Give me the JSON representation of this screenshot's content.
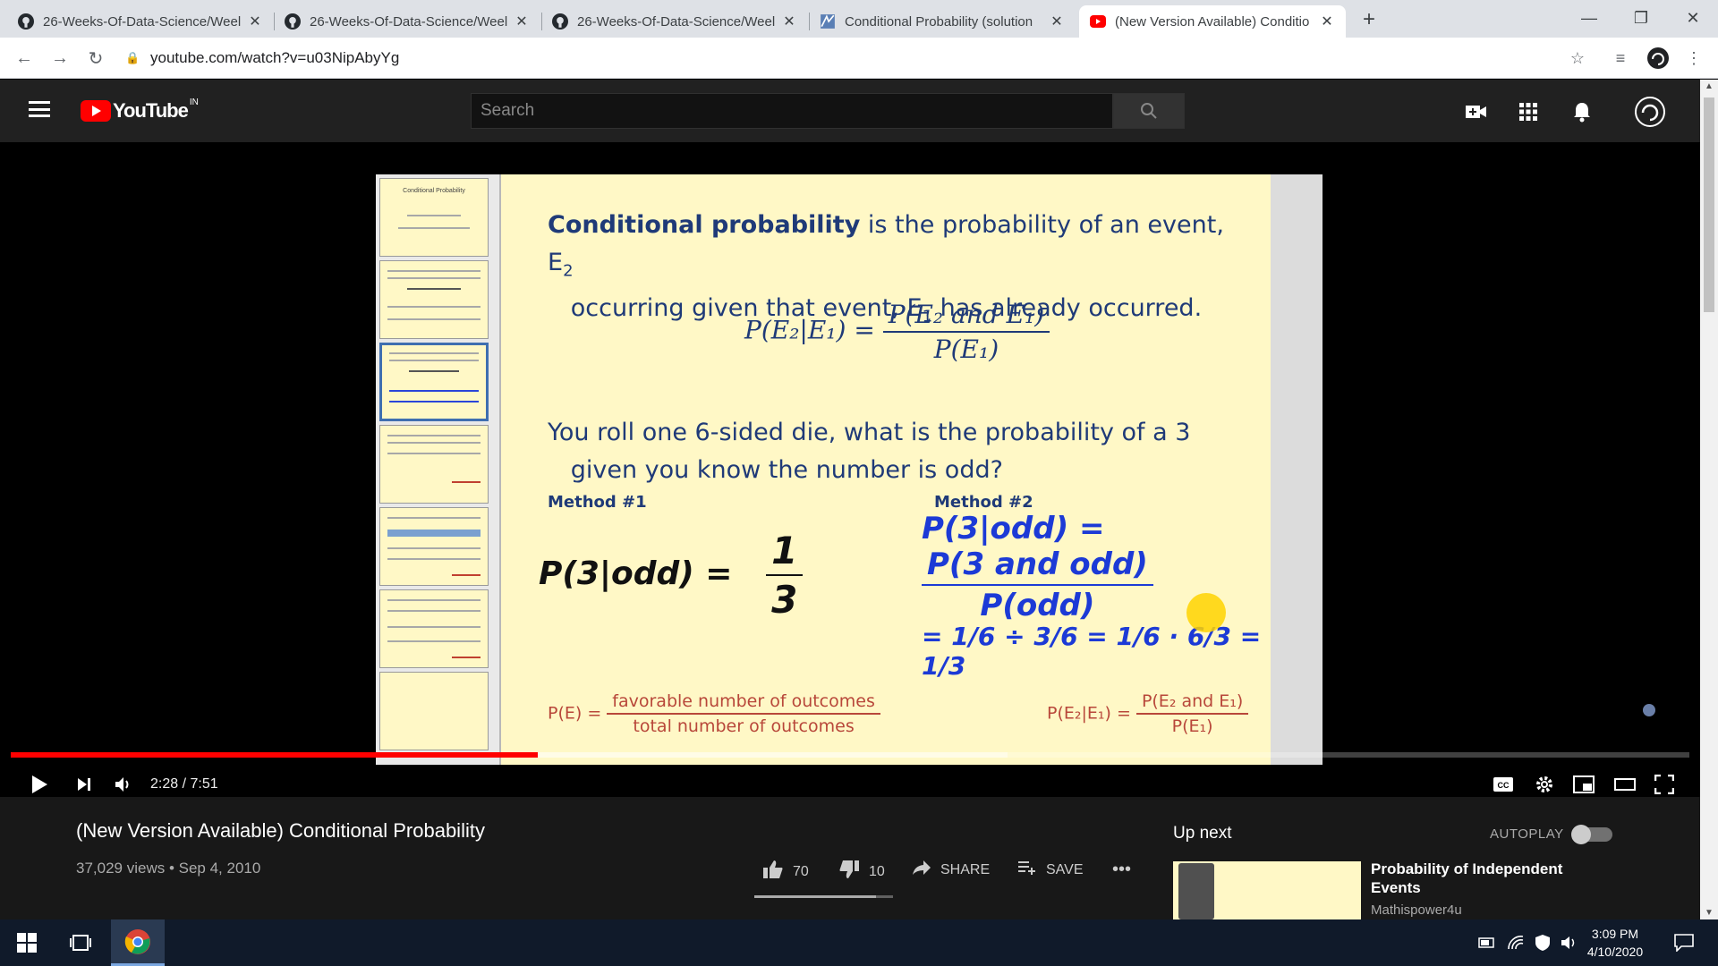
{
  "browser": {
    "tabs": [
      {
        "title": "26-Weeks-Of-Data-Science/Weel",
        "icon": "github-icon"
      },
      {
        "title": "26-Weeks-Of-Data-Science/Weel",
        "icon": "github-icon"
      },
      {
        "title": "26-Weeks-Of-Data-Science/Weel",
        "icon": "github-icon"
      },
      {
        "title": "Conditional Probability (solution",
        "icon": "site-icon"
      },
      {
        "title": "(New Version Available) Conditio",
        "icon": "youtube-icon"
      }
    ],
    "url": "youtube.com/watch?v=u03NipAbyYg"
  },
  "youtube": {
    "logo_text": "YouTube",
    "region": "IN",
    "search_placeholder": "Search"
  },
  "slide": {
    "definition_lead": "Conditional probability",
    "definition_rest": " is the probability of an event, E",
    "definition_sub2": "2",
    "definition_line2a": "occurring given that event, E",
    "definition_sub1": "1",
    "definition_line2b": " has already occurred.",
    "formula_lhs": "P(E₂|E₁) =",
    "formula_num": "P(E₂ and E₁)",
    "formula_den": "P(E₁)",
    "question_line1": "You roll one 6-sided die, what is the probability of a 3",
    "question_line2": "given you know the number is odd?",
    "method1": "Method #1",
    "method2": "Method #2",
    "hand1_lhs": "P(3|odd) =",
    "hand1_num": "1",
    "hand1_den": "3",
    "hand2_lhs": "P(3|odd) =",
    "hand2_num": "P(3 and odd)",
    "hand2_den": "P(odd)",
    "hand2_line2": "= 1/6 ÷ 3/6 = 1/6 · 6/3 = 1/3",
    "red1_lhs": "P(E) =",
    "red1_num": "favorable number of outcomes",
    "red1_den": "total number of outcomes",
    "red2_lhs": "P(E₂|E₁) =",
    "red2_num": "P(E₂ and E₁)",
    "red2_den": "P(E₁)",
    "thumb_title": "Conditional Probability"
  },
  "player": {
    "time": "2:28 / 7:51",
    "played_fraction": 0.314,
    "loaded_fraction": 0.28
  },
  "video": {
    "title": "(New Version Available) Conditional Probability",
    "meta": "37,029 views • Sep 4, 2010",
    "likes": "70",
    "dislikes": "10",
    "share": "SHARE",
    "save": "SAVE",
    "like_ratio": 0.875
  },
  "upnext": {
    "label": "Up next",
    "autoplay": "AUTOPLAY",
    "title": "Probability of Independent Events",
    "channel": "Mathispower4u"
  },
  "taskbar": {
    "time": "3:09 PM",
    "date": "4/10/2020"
  },
  "colors": {
    "slide_text": "#1f3a78",
    "handwriting_blue": "#1c3ad6",
    "accent_red": "#ff0000"
  }
}
